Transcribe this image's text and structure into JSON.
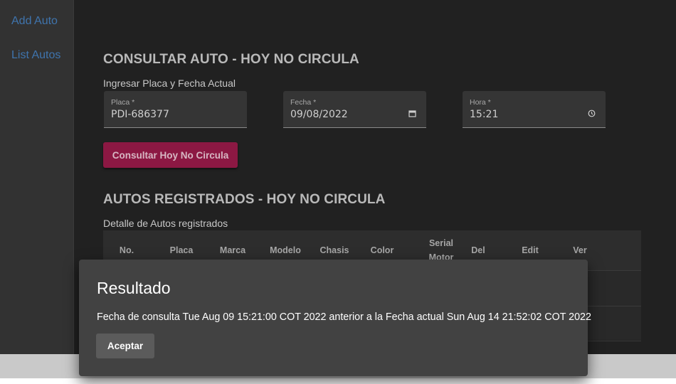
{
  "sidebar": {
    "items": [
      {
        "label": "Add Auto"
      },
      {
        "label": "List Autos"
      }
    ]
  },
  "consult": {
    "title": "CONSULTAR AUTO - HOY NO CIRCULA",
    "subtitle": "Ingresar Placa y Fecha Actual",
    "placa": {
      "label": "Placa *",
      "value": "PDI-686377"
    },
    "fecha": {
      "label": "Fecha *",
      "value": "09/08/2022",
      "icon": "calendar-icon"
    },
    "hora": {
      "label": "Hora *",
      "value": "15:21",
      "icon": "clock-icon"
    },
    "button": "Consultar Hoy No Circula"
  },
  "registered": {
    "title": "AUTOS REGISTRADOS - HOY NO CIRCULA",
    "subtitle": "Detalle de Autos registrados",
    "columns": [
      "No.",
      "Placa",
      "Marca",
      "Modelo",
      "Chasis",
      "Color",
      "Serial Motor",
      "Del",
      "Edit",
      "Ver"
    ]
  },
  "dialog": {
    "title": "Resultado",
    "message": "Fecha de consulta Tue Aug 09 15:21:00 COT 2022 anterior a la Fecha actual Sun Aug 14 21:52:02 COT 2022",
    "button": "Aceptar"
  },
  "colors": {
    "accent": "#8c1843",
    "link": "#3f74ad",
    "background": "#212121",
    "dialog": "#424242"
  }
}
